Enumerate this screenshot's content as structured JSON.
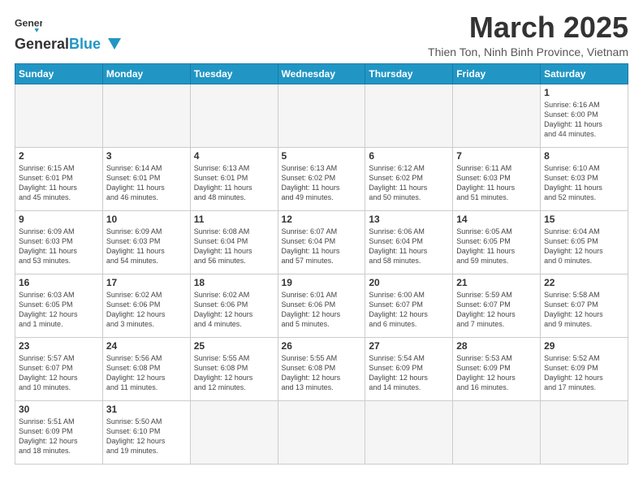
{
  "header": {
    "logo_general": "General",
    "logo_blue": "Blue",
    "month_title": "March 2025",
    "location": "Thien Ton, Ninh Binh Province, Vietnam"
  },
  "weekdays": [
    "Sunday",
    "Monday",
    "Tuesday",
    "Wednesday",
    "Thursday",
    "Friday",
    "Saturday"
  ],
  "weeks": [
    [
      {
        "day": "",
        "info": ""
      },
      {
        "day": "",
        "info": ""
      },
      {
        "day": "",
        "info": ""
      },
      {
        "day": "",
        "info": ""
      },
      {
        "day": "",
        "info": ""
      },
      {
        "day": "",
        "info": ""
      },
      {
        "day": "1",
        "info": "Sunrise: 6:16 AM\nSunset: 6:00 PM\nDaylight: 11 hours\nand 44 minutes."
      }
    ],
    [
      {
        "day": "2",
        "info": "Sunrise: 6:15 AM\nSunset: 6:01 PM\nDaylight: 11 hours\nand 45 minutes."
      },
      {
        "day": "3",
        "info": "Sunrise: 6:14 AM\nSunset: 6:01 PM\nDaylight: 11 hours\nand 46 minutes."
      },
      {
        "day": "4",
        "info": "Sunrise: 6:13 AM\nSunset: 6:01 PM\nDaylight: 11 hours\nand 48 minutes."
      },
      {
        "day": "5",
        "info": "Sunrise: 6:13 AM\nSunset: 6:02 PM\nDaylight: 11 hours\nand 49 minutes."
      },
      {
        "day": "6",
        "info": "Sunrise: 6:12 AM\nSunset: 6:02 PM\nDaylight: 11 hours\nand 50 minutes."
      },
      {
        "day": "7",
        "info": "Sunrise: 6:11 AM\nSunset: 6:03 PM\nDaylight: 11 hours\nand 51 minutes."
      },
      {
        "day": "8",
        "info": "Sunrise: 6:10 AM\nSunset: 6:03 PM\nDaylight: 11 hours\nand 52 minutes."
      }
    ],
    [
      {
        "day": "9",
        "info": "Sunrise: 6:09 AM\nSunset: 6:03 PM\nDaylight: 11 hours\nand 53 minutes."
      },
      {
        "day": "10",
        "info": "Sunrise: 6:09 AM\nSunset: 6:03 PM\nDaylight: 11 hours\nand 54 minutes."
      },
      {
        "day": "11",
        "info": "Sunrise: 6:08 AM\nSunset: 6:04 PM\nDaylight: 11 hours\nand 56 minutes."
      },
      {
        "day": "12",
        "info": "Sunrise: 6:07 AM\nSunset: 6:04 PM\nDaylight: 11 hours\nand 57 minutes."
      },
      {
        "day": "13",
        "info": "Sunrise: 6:06 AM\nSunset: 6:04 PM\nDaylight: 11 hours\nand 58 minutes."
      },
      {
        "day": "14",
        "info": "Sunrise: 6:05 AM\nSunset: 6:05 PM\nDaylight: 11 hours\nand 59 minutes."
      },
      {
        "day": "15",
        "info": "Sunrise: 6:04 AM\nSunset: 6:05 PM\nDaylight: 12 hours\nand 0 minutes."
      }
    ],
    [
      {
        "day": "16",
        "info": "Sunrise: 6:03 AM\nSunset: 6:05 PM\nDaylight: 12 hours\nand 1 minute."
      },
      {
        "day": "17",
        "info": "Sunrise: 6:02 AM\nSunset: 6:06 PM\nDaylight: 12 hours\nand 3 minutes."
      },
      {
        "day": "18",
        "info": "Sunrise: 6:02 AM\nSunset: 6:06 PM\nDaylight: 12 hours\nand 4 minutes."
      },
      {
        "day": "19",
        "info": "Sunrise: 6:01 AM\nSunset: 6:06 PM\nDaylight: 12 hours\nand 5 minutes."
      },
      {
        "day": "20",
        "info": "Sunrise: 6:00 AM\nSunset: 6:07 PM\nDaylight: 12 hours\nand 6 minutes."
      },
      {
        "day": "21",
        "info": "Sunrise: 5:59 AM\nSunset: 6:07 PM\nDaylight: 12 hours\nand 7 minutes."
      },
      {
        "day": "22",
        "info": "Sunrise: 5:58 AM\nSunset: 6:07 PM\nDaylight: 12 hours\nand 9 minutes."
      }
    ],
    [
      {
        "day": "23",
        "info": "Sunrise: 5:57 AM\nSunset: 6:07 PM\nDaylight: 12 hours\nand 10 minutes."
      },
      {
        "day": "24",
        "info": "Sunrise: 5:56 AM\nSunset: 6:08 PM\nDaylight: 12 hours\nand 11 minutes."
      },
      {
        "day": "25",
        "info": "Sunrise: 5:55 AM\nSunset: 6:08 PM\nDaylight: 12 hours\nand 12 minutes."
      },
      {
        "day": "26",
        "info": "Sunrise: 5:55 AM\nSunset: 6:08 PM\nDaylight: 12 hours\nand 13 minutes."
      },
      {
        "day": "27",
        "info": "Sunrise: 5:54 AM\nSunset: 6:09 PM\nDaylight: 12 hours\nand 14 minutes."
      },
      {
        "day": "28",
        "info": "Sunrise: 5:53 AM\nSunset: 6:09 PM\nDaylight: 12 hours\nand 16 minutes."
      },
      {
        "day": "29",
        "info": "Sunrise: 5:52 AM\nSunset: 6:09 PM\nDaylight: 12 hours\nand 17 minutes."
      }
    ],
    [
      {
        "day": "30",
        "info": "Sunrise: 5:51 AM\nSunset: 6:09 PM\nDaylight: 12 hours\nand 18 minutes."
      },
      {
        "day": "31",
        "info": "Sunrise: 5:50 AM\nSunset: 6:10 PM\nDaylight: 12 hours\nand 19 minutes."
      },
      {
        "day": "",
        "info": ""
      },
      {
        "day": "",
        "info": ""
      },
      {
        "day": "",
        "info": ""
      },
      {
        "day": "",
        "info": ""
      },
      {
        "day": "",
        "info": ""
      }
    ]
  ]
}
